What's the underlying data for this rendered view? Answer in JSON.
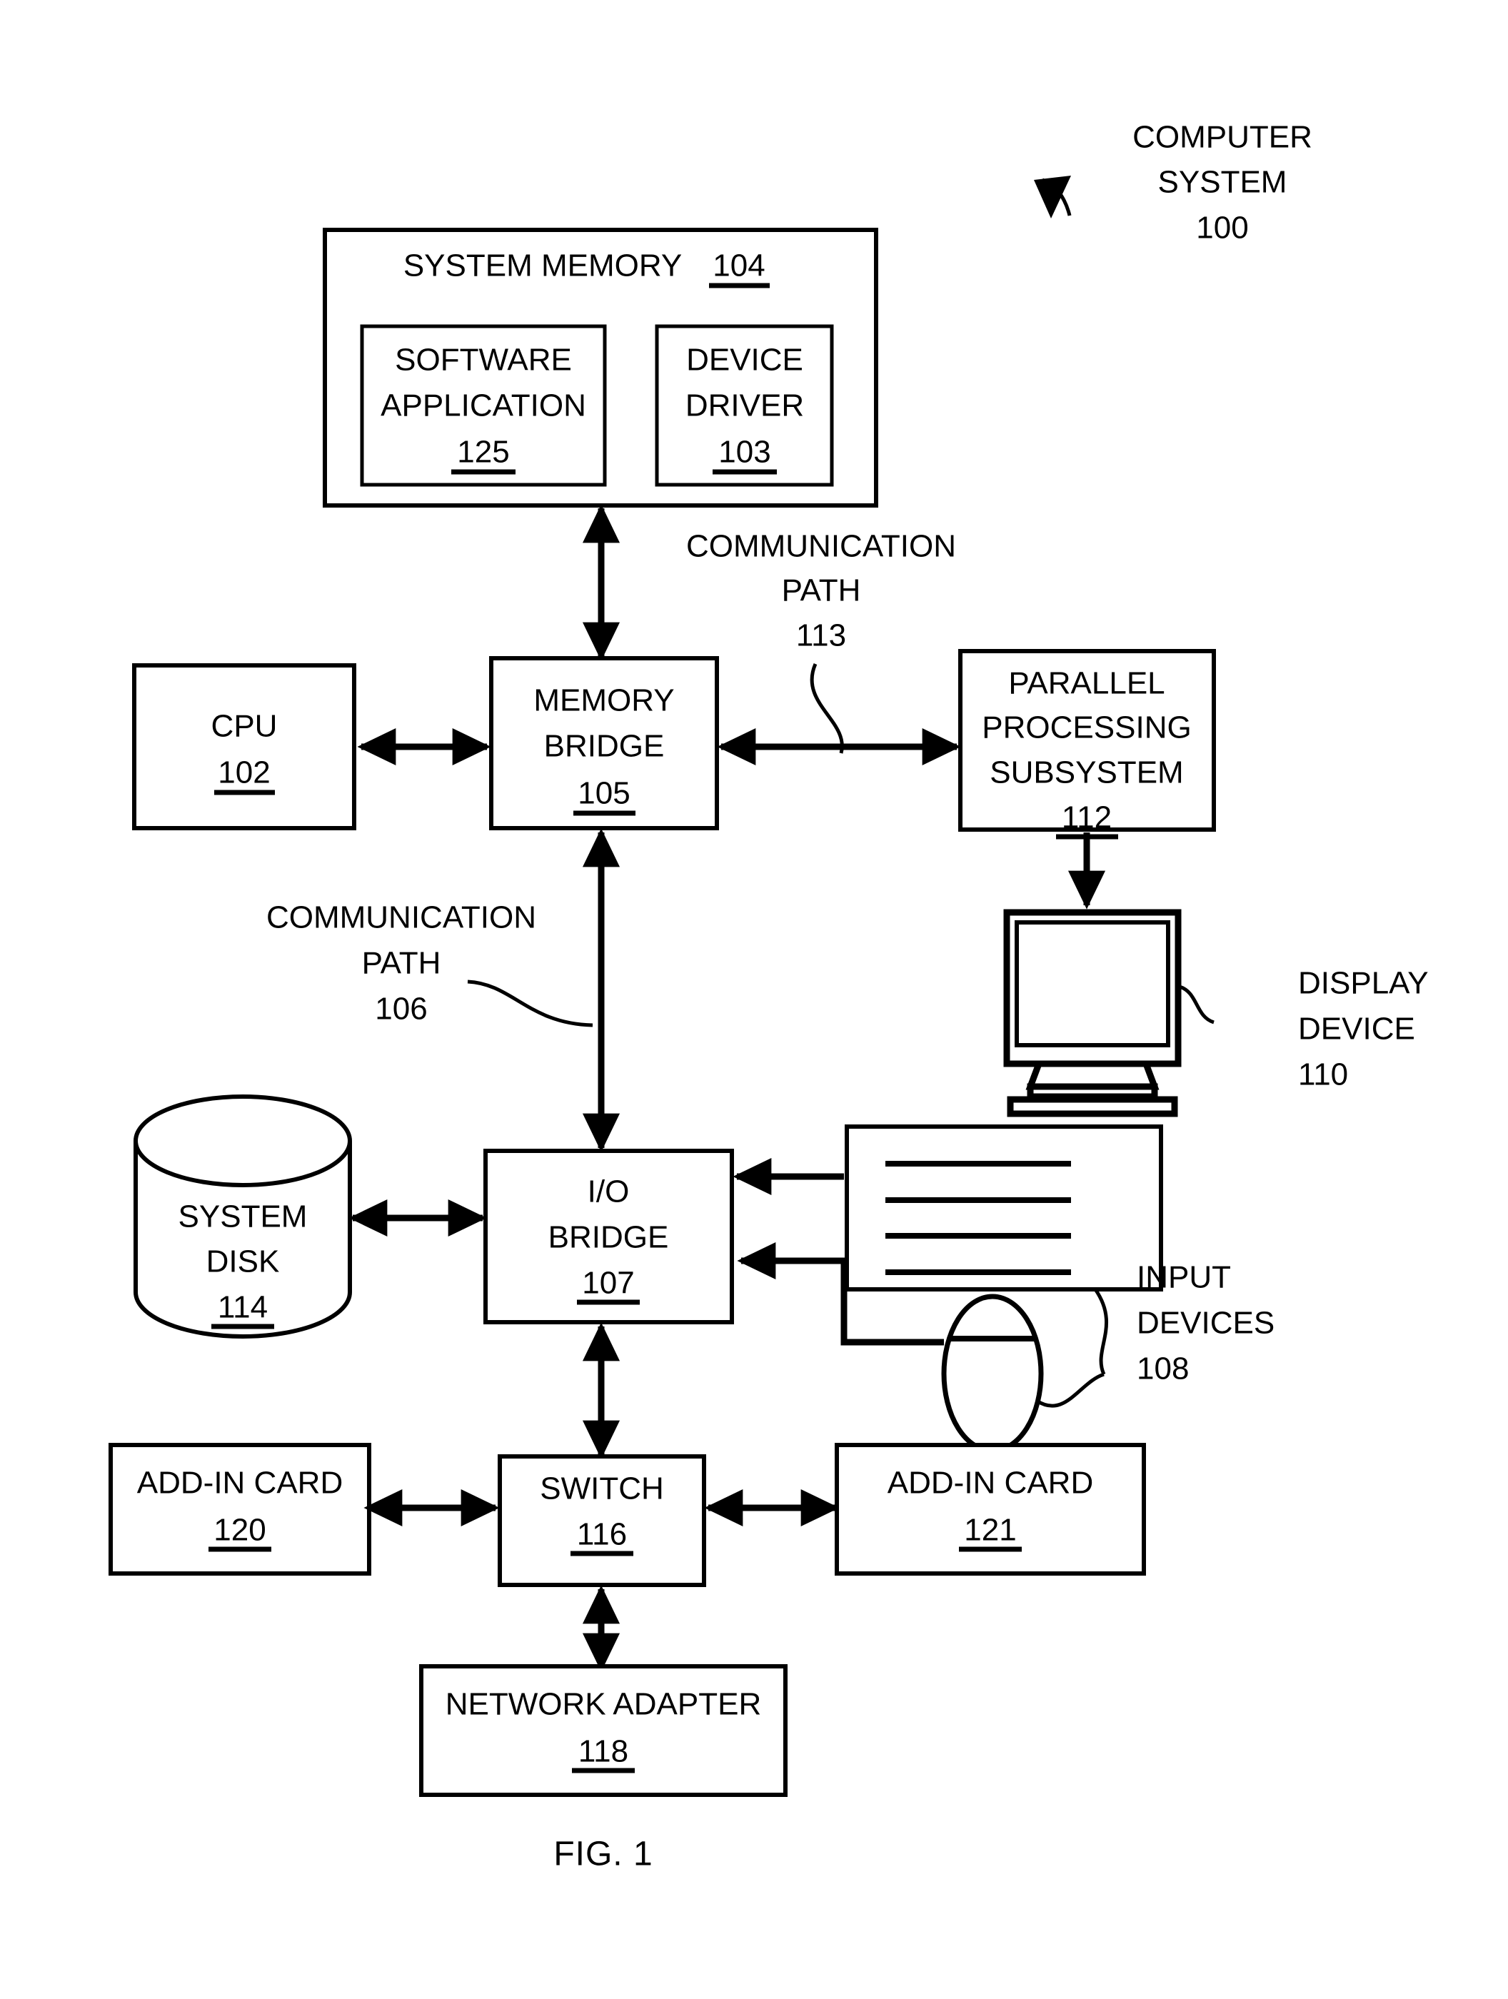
{
  "figure": {
    "caption": "FIG. 1",
    "title_callout": {
      "line1": "COMPUTER",
      "line2": "SYSTEM",
      "ref": "100"
    }
  },
  "blocks": {
    "system_memory": {
      "label": "SYSTEM MEMORY",
      "ref": "104",
      "children": {
        "software_application": {
          "line1": "SOFTWARE",
          "line2": "APPLICATION",
          "ref": "125"
        },
        "device_driver": {
          "line1": "DEVICE",
          "line2": "DRIVER",
          "ref": "103"
        }
      }
    },
    "cpu": {
      "label": "CPU",
      "ref": "102"
    },
    "memory_bridge": {
      "line1": "MEMORY",
      "line2": "BRIDGE",
      "ref": "105"
    },
    "parallel_processing_subsystem": {
      "line1": "PARALLEL",
      "line2": "PROCESSING",
      "line3": "SUBSYSTEM",
      "ref": "112"
    },
    "display_device": {
      "line1": "DISPLAY",
      "line2": "DEVICE",
      "ref": "110"
    },
    "system_disk": {
      "line1": "SYSTEM",
      "line2": "DISK",
      "ref": "114"
    },
    "io_bridge": {
      "line1": "I/O",
      "line2": "BRIDGE",
      "ref": "107"
    },
    "input_devices": {
      "line1": "INPUT",
      "line2": "DEVICES",
      "ref": "108"
    },
    "add_in_card_left": {
      "label": "ADD-IN CARD",
      "ref": "120"
    },
    "switch": {
      "label": "SWITCH",
      "ref": "116"
    },
    "add_in_card_right": {
      "label": "ADD-IN CARD",
      "ref": "121"
    },
    "network_adapter": {
      "label": "NETWORK ADAPTER",
      "ref": "118"
    }
  },
  "callouts": {
    "communication_path_113": {
      "line1": "COMMUNICATION",
      "line2": "PATH",
      "ref": "113"
    },
    "communication_path_106": {
      "line1": "COMMUNICATION",
      "line2": "PATH",
      "ref": "106"
    }
  },
  "colors": {
    "ink": "#000000",
    "paper": "#ffffff"
  }
}
